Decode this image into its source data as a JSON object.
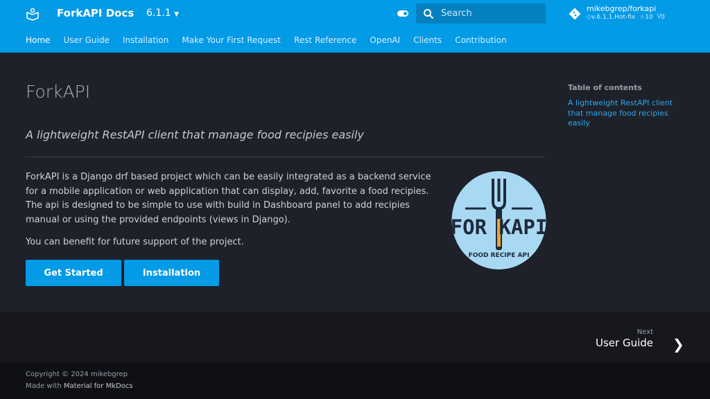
{
  "header": {
    "site_title": "ForkAPI Docs",
    "version": "6.1.1",
    "search_placeholder": "Search",
    "repo": {
      "name": "mikebgrep/forkapi",
      "tag": "v.6.1.1.Hot-fix",
      "stars": "10",
      "forks": "0"
    }
  },
  "tabs": [
    "Home",
    "User Guide",
    "Installation",
    "Make Your First Request",
    "Rest Reference",
    "OpenAI",
    "Clients",
    "Contribution"
  ],
  "main": {
    "title": "ForkAPI",
    "tagline": "A lightweight RestAPI client that manage food recipies easily",
    "paragraph": "ForkAPI is a Django drf based project which can be easily integrated as a backend service for a mobile application or web application that can display, add, favorite a food recipies. The api is designed to be simple to use with build in Dashboard panel to add recipies manual or using the provided endpoints (views in Django).",
    "paragraph2": "You can benefit for future support of the project.",
    "get_started": "Get Started",
    "installation": "Installation",
    "logo_text": "FORKAPI",
    "logo_subtext": "FOOD RECIPE API"
  },
  "toc": {
    "title": "Table of contents",
    "link": "A lightweight RestAPI client that manage food recipies easily"
  },
  "next": {
    "label": "Next",
    "title": "User Guide"
  },
  "footer": {
    "copyright": "Copyright © 2024 mikebgrep",
    "made_with": "Made with",
    "made_link": "Material for MkDocs"
  }
}
